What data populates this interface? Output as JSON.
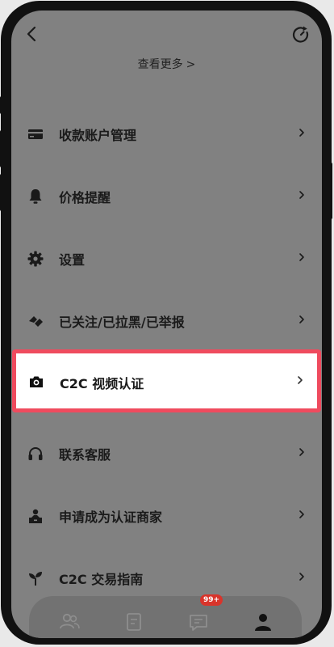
{
  "header": {
    "see_more": "查看更多",
    "see_more_chevron": ">"
  },
  "menu": [
    {
      "label": "收款账户管理",
      "icon": "card-icon"
    },
    {
      "label": "价格提醒",
      "icon": "bell-icon"
    },
    {
      "label": "设置",
      "icon": "gear-icon"
    },
    {
      "label": "已关注/已拉黑/已举报",
      "icon": "tag-icon"
    },
    {
      "label": "C2C 视频认证",
      "icon": "camera-icon",
      "highlighted": true
    },
    {
      "label": "联系客服",
      "icon": "headset-icon"
    },
    {
      "label": "申请成为认证商家",
      "icon": "merchant-icon"
    },
    {
      "label": "C2C 交易指南",
      "icon": "sprout-icon"
    }
  ],
  "tabbar": {
    "badge": "99+"
  },
  "colors": {
    "highlight_border": "#ef4b5e",
    "overlay": "#818181",
    "badge": "#d9342b"
  }
}
